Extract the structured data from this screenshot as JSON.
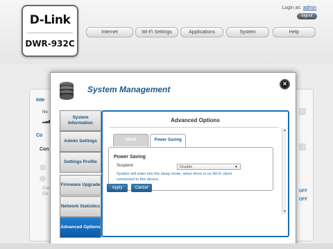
{
  "header": {
    "logo_brand": "D-Link",
    "logo_model": "DWR-932C",
    "login_prefix": "Login as",
    "login_user": "admin",
    "logout_label": "logout",
    "nav": [
      {
        "label": "Internet"
      },
      {
        "label": "Wi-Fi Settings"
      },
      {
        "label": "Applications"
      },
      {
        "label": "System"
      },
      {
        "label": "Help"
      }
    ]
  },
  "background": {
    "row_inte": "Inte",
    "row_no": "No",
    "row_co": "Co",
    "row_con": "Con",
    "row_con2": "Con",
    "row_dis": "Dis",
    "off_1": "OFF",
    "off_2": "OFF"
  },
  "modal": {
    "title": "System Management",
    "sidebar": [
      {
        "label": "System Information"
      },
      {
        "label": "Admin Settings"
      },
      {
        "label": "Settings Profile"
      },
      {
        "label": "Firmware Upgrade"
      },
      {
        "label": "Network Statistics"
      },
      {
        "label": "Advanced Options"
      }
    ],
    "content_title": "Advanced Options",
    "tabs": [
      {
        "label": "UPnP"
      },
      {
        "label": "Power Saving"
      }
    ],
    "section_title": "Power Saving",
    "field_label": "Suspend",
    "select_value": "Disable",
    "note": "System will enter into the sleep mode, when there is no Wi-Fi client connected to this device.",
    "apply_label": "Apply",
    "cancel_label": "Cancel"
  }
}
